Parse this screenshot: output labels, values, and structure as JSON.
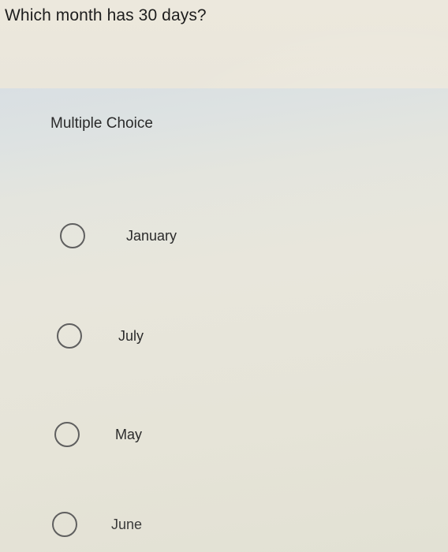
{
  "question": "Which month has 30 days?",
  "panel_label": "Multiple Choice",
  "options": [
    {
      "label": "January"
    },
    {
      "label": "July"
    },
    {
      "label": "May"
    },
    {
      "label": "June"
    }
  ]
}
